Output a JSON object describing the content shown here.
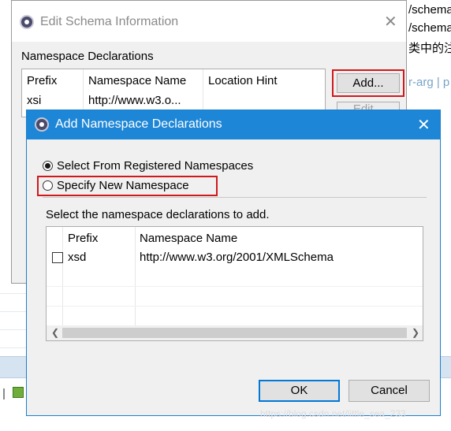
{
  "background": {
    "right_texts": [
      "/schema",
      "/schema",
      "类中的注"
    ],
    "right_link": "r-arg | p"
  },
  "edit_window": {
    "title": "Edit Schema Information",
    "section_label": "Namespace Declarations",
    "columns": [
      "Prefix",
      "Namespace Name",
      "Location Hint"
    ],
    "rows": [
      {
        "prefix": "xsi",
        "namespace": "http://www.w3.o...",
        "hint": ""
      }
    ],
    "add_button": "Add...",
    "edit_button": "Edit..."
  },
  "add_dialog": {
    "title": "Add Namespace Declarations",
    "radio_registered": "Select From Registered Namespaces",
    "radio_new": "Specify New Namespace",
    "instruction": "Select the namespace declarations to add.",
    "columns": [
      "Prefix",
      "Namespace Name"
    ],
    "rows": [
      {
        "prefix": "xsd",
        "namespace": "http://www.w3.org/2001/XMLSchema",
        "checked": false
      }
    ],
    "ok_button": "OK",
    "cancel_button": "Cancel",
    "watermark": "https://blog.csdn.net/little_sea_233"
  },
  "colors": {
    "dialog_titlebar": "#1e86d6",
    "highlight_border": "#d0191a"
  }
}
